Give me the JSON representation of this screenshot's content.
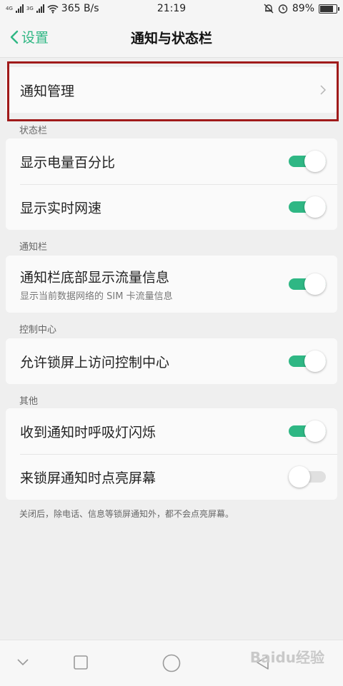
{
  "status_bar": {
    "net1": "4G",
    "net2": "3G",
    "speed": "365 B/s",
    "time": "21:19",
    "battery": "89%",
    "battery_level": 0.89
  },
  "header": {
    "back_label": "设置",
    "title": "通知与状态栏"
  },
  "notification_management": {
    "label": "通知管理"
  },
  "sections": {
    "status_bar": "状态栏",
    "notification_bar": "通知栏",
    "control_center": "控制中心",
    "other": "其他"
  },
  "settings": {
    "battery_percent": {
      "label": "显示电量百分比",
      "on": true
    },
    "realtime_speed": {
      "label": "显示实时网速",
      "on": true
    },
    "traffic_info": {
      "label": "通知栏底部显示流量信息",
      "desc": "显示当前数据网络的 SIM 卡流量信息",
      "on": true
    },
    "lockscreen_control": {
      "label": "允许锁屏上访问控制中心",
      "on": true
    },
    "breathing_light": {
      "label": "收到通知时呼吸灯闪烁",
      "on": true
    },
    "light_up_screen": {
      "label": "来锁屏通知时点亮屏幕",
      "on": false
    }
  },
  "footer_note": "关闭后，除电话、信息等锁屏通知外，都不会点亮屏幕。",
  "watermark": "Baidu经验",
  "colors": {
    "accent": "#2fb784",
    "highlight_border": "#a01a1a"
  }
}
